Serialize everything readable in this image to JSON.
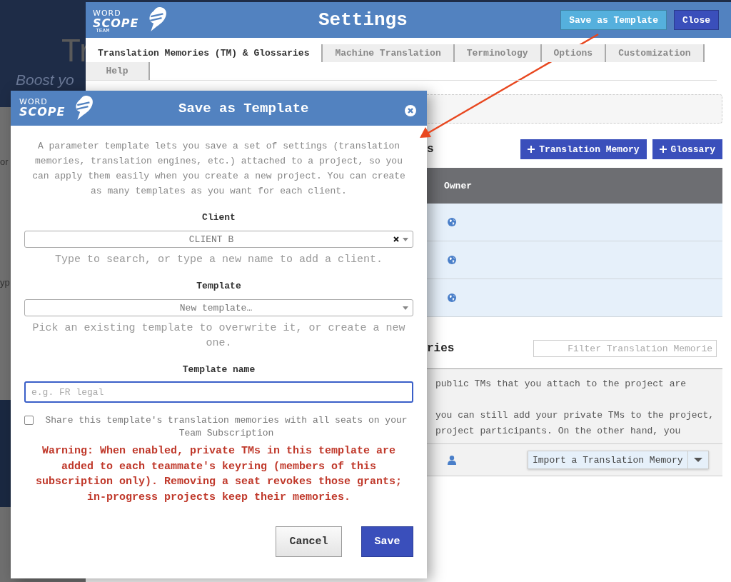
{
  "background_page": {
    "title_fragment": "Tr",
    "subtitle_fragment": "Boost yo",
    "side_fragments": [
      "or",
      "yp"
    ]
  },
  "settings": {
    "logo": {
      "word": "WORD",
      "scope": "SCOPE",
      "edition": "TEAM"
    },
    "title": "Settings",
    "buttons": [
      {
        "label": "Save as Template",
        "kind": "secondary"
      },
      {
        "label": "Close",
        "kind": "primary"
      }
    ],
    "tabs": [
      {
        "label": "Translation Memories (TM) & Glossaries",
        "selected": true
      },
      {
        "label": "Machine Translation",
        "selected": false
      },
      {
        "label": "Terminology",
        "selected": false
      },
      {
        "label": "Options",
        "selected": false
      },
      {
        "label": "Customization",
        "selected": false
      },
      {
        "label": "Help",
        "selected": false
      }
    ],
    "section_1": {
      "heading_fragment": "s",
      "buttons": [
        {
          "label": "Translation Memory"
        },
        {
          "label": "Glossary"
        }
      ],
      "table": {
        "columns": [
          "Owner"
        ],
        "rows": [
          {
            "kind": "public"
          },
          {
            "kind": "public"
          },
          {
            "kind": "public"
          }
        ]
      }
    },
    "section_2": {
      "heading_fragment": "ries",
      "filter": {
        "placeholder": "Filter Translation Memorie"
      },
      "info": [
        [
          "public TMs that you attach to the project are"
        ],
        [
          "you can still add your private TMs to the project,",
          "project participants. On the other hand, you"
        ]
      ],
      "row": {
        "kind": "private",
        "import_button": "Import a Translation Memory"
      }
    }
  },
  "dialog": {
    "logo": {
      "word": "WORD",
      "scope": "SCOPE"
    },
    "title": "Save as Template",
    "description": "A parameter template lets you save a set of settings (translation memories, translation engines, etc.) attached to a project, so you can apply them easily when you create a new project. You can create as many templates as you want for each client.",
    "fields": [
      {
        "label": "Client",
        "kind": "select",
        "value": "CLIENT B",
        "clearable": true,
        "help": "Type to search, or type a new name to add a client."
      },
      {
        "label": "Template",
        "kind": "select",
        "value": "New template…",
        "clearable": false,
        "help": "Pick an existing template to overwrite it, or create a new one."
      },
      {
        "label": "Template name",
        "kind": "input",
        "placeholder": "e.g. FR legal",
        "focused": true
      }
    ],
    "share": {
      "label": "Share this template's translation memories with all seats on your Team Subscription",
      "checked": false
    },
    "warning": "Warning: When enabled, private TMs in this template are added to each teammate's keyring (members of this subscription only). Removing a seat revokes those grants; in-progress projects keep their memories.",
    "buttons": [
      {
        "label": "Cancel",
        "kind": "default"
      },
      {
        "label": "Save",
        "kind": "primary"
      }
    ]
  }
}
